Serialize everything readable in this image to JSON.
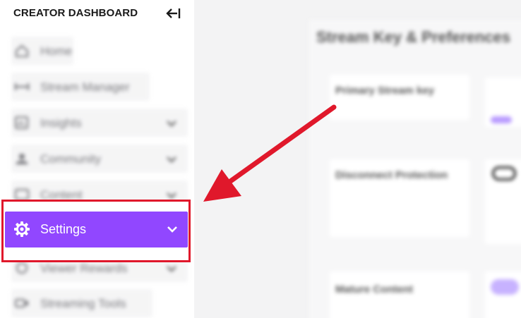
{
  "sidebar": {
    "title": "CREATOR DASHBOARD",
    "items": [
      {
        "label": "Home",
        "icon": "home-icon",
        "has_chevron": false
      },
      {
        "label": "Stream Manager",
        "icon": "stream-manager-icon",
        "has_chevron": false
      },
      {
        "label": "Insights",
        "icon": "insights-icon",
        "has_chevron": true
      },
      {
        "label": "Community",
        "icon": "community-icon",
        "has_chevron": true
      },
      {
        "label": "Content",
        "icon": "content-icon",
        "has_chevron": true
      },
      {
        "label": "Settings",
        "icon": "gear-icon",
        "has_chevron": true,
        "selected": true
      },
      {
        "label": "Viewer Rewards",
        "icon": "rewards-icon",
        "has_chevron": true
      },
      {
        "label": "Streaming Tools",
        "icon": "streaming-tools-icon",
        "has_chevron": false
      }
    ]
  },
  "main": {
    "title": "Stream Key & Preferences",
    "sections": [
      {
        "label": "Primary Stream key"
      },
      {
        "label": "Disconnect Protection"
      },
      {
        "label": "Mature Content"
      }
    ]
  },
  "colors": {
    "accent": "#9147ff",
    "highlight": "#e0182b"
  }
}
